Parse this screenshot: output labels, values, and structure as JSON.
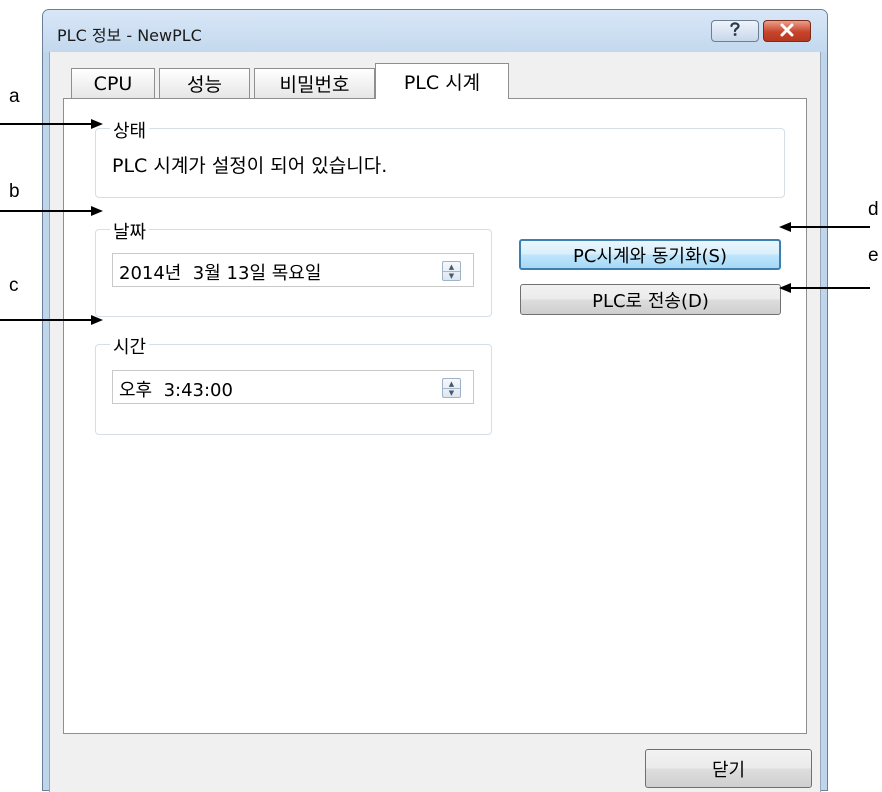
{
  "window": {
    "title": "PLC 정보 - NewPLC"
  },
  "titlebar_buttons": {
    "help_icon": "help-icon",
    "close_icon": "close-icon"
  },
  "tabs": [
    {
      "label": "CPU",
      "active": false
    },
    {
      "label": "성능",
      "active": false
    },
    {
      "label": "비밀번호",
      "active": false
    },
    {
      "label": "PLC 시계",
      "active": true
    }
  ],
  "status_group": {
    "legend": "상태",
    "text": "PLC 시계가 설정이 되어 있습니다."
  },
  "date_group": {
    "legend": "날짜",
    "value": "2014년  3월 13일 목요일"
  },
  "time_group": {
    "legend": "시간",
    "value": "오후  3:43:00"
  },
  "buttons": {
    "sync_pc": "PC시계와 동기화(S)",
    "send_plc": "PLC로 전송(D)",
    "close": "닫기"
  },
  "annotations": {
    "a": "a",
    "b": "b",
    "c": "c",
    "d": "d",
    "e": "e"
  },
  "colors": {
    "focus_border": "#3c7fb1",
    "titlebar": "#c3d8ee",
    "close_red": "#c7442b"
  }
}
